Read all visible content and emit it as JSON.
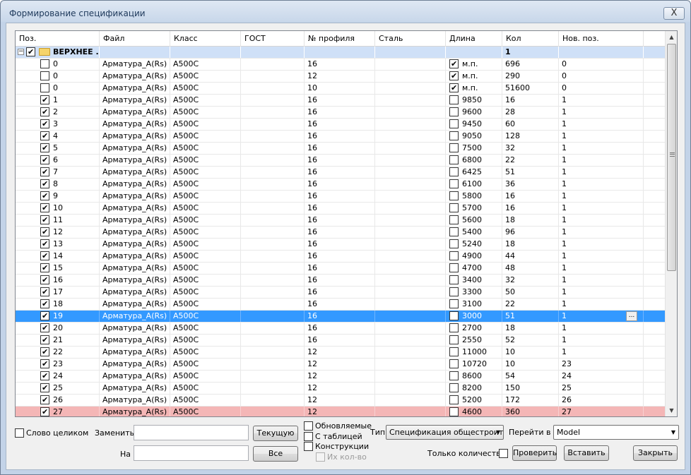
{
  "window": {
    "title": "Формирование спецификации",
    "close_glyph": "X"
  },
  "grid": {
    "columns": [
      "Поз.",
      "Файл",
      "Класс",
      "ГОСТ",
      "№ профиля",
      "Сталь",
      "Длина",
      "Кол",
      "Нов. поз."
    ],
    "group_row": {
      "name": "ВЕРХНЕЕ .",
      "qty": "1",
      "checked": true
    },
    "rows": [
      {
        "pos": "0",
        "checked": false,
        "file": "Арматура_A(Rs)",
        "cls": "A500C",
        "gost": "",
        "profile": "16",
        "steel": "",
        "len_checked": true,
        "len": "м.п.",
        "qty": "696",
        "newpos": "0"
      },
      {
        "pos": "0",
        "checked": false,
        "file": "Арматура_A(Rs)",
        "cls": "A500C",
        "gost": "",
        "profile": "12",
        "steel": "",
        "len_checked": true,
        "len": "м.п.",
        "qty": "290",
        "newpos": "0"
      },
      {
        "pos": "0",
        "checked": false,
        "file": "Арматура_A(Rs)",
        "cls": "A500C",
        "gost": "",
        "profile": "10",
        "steel": "",
        "len_checked": true,
        "len": "м.п.",
        "qty": "51600",
        "newpos": "0"
      },
      {
        "pos": "1",
        "checked": true,
        "file": "Арматура_A(Rs)",
        "cls": "A500C",
        "gost": "",
        "profile": "16",
        "steel": "",
        "len_checked": false,
        "len": "9850",
        "qty": "16",
        "newpos": "1"
      },
      {
        "pos": "2",
        "checked": true,
        "file": "Арматура_A(Rs)",
        "cls": "A500C",
        "gost": "",
        "profile": "16",
        "steel": "",
        "len_checked": false,
        "len": "9600",
        "qty": "28",
        "newpos": "1"
      },
      {
        "pos": "3",
        "checked": true,
        "file": "Арматура_A(Rs)",
        "cls": "A500C",
        "gost": "",
        "profile": "16",
        "steel": "",
        "len_checked": false,
        "len": "9450",
        "qty": "60",
        "newpos": "1"
      },
      {
        "pos": "4",
        "checked": true,
        "file": "Арматура_A(Rs)",
        "cls": "A500C",
        "gost": "",
        "profile": "16",
        "steel": "",
        "len_checked": false,
        "len": "9050",
        "qty": "128",
        "newpos": "1"
      },
      {
        "pos": "5",
        "checked": true,
        "file": "Арматура_A(Rs)",
        "cls": "A500C",
        "gost": "",
        "profile": "16",
        "steel": "",
        "len_checked": false,
        "len": "7500",
        "qty": "32",
        "newpos": "1"
      },
      {
        "pos": "6",
        "checked": true,
        "file": "Арматура_A(Rs)",
        "cls": "A500C",
        "gost": "",
        "profile": "16",
        "steel": "",
        "len_checked": false,
        "len": "6800",
        "qty": "22",
        "newpos": "1"
      },
      {
        "pos": "7",
        "checked": true,
        "file": "Арматура_A(Rs)",
        "cls": "A500C",
        "gost": "",
        "profile": "16",
        "steel": "",
        "len_checked": false,
        "len": "6425",
        "qty": "51",
        "newpos": "1"
      },
      {
        "pos": "8",
        "checked": true,
        "file": "Арматура_A(Rs)",
        "cls": "A500C",
        "gost": "",
        "profile": "16",
        "steel": "",
        "len_checked": false,
        "len": "6100",
        "qty": "36",
        "newpos": "1"
      },
      {
        "pos": "9",
        "checked": true,
        "file": "Арматура_A(Rs)",
        "cls": "A500C",
        "gost": "",
        "profile": "16",
        "steel": "",
        "len_checked": false,
        "len": "5800",
        "qty": "16",
        "newpos": "1"
      },
      {
        "pos": "10",
        "checked": true,
        "file": "Арматура_A(Rs)",
        "cls": "A500C",
        "gost": "",
        "profile": "16",
        "steel": "",
        "len_checked": false,
        "len": "5700",
        "qty": "16",
        "newpos": "1"
      },
      {
        "pos": "11",
        "checked": true,
        "file": "Арматура_A(Rs)",
        "cls": "A500C",
        "gost": "",
        "profile": "16",
        "steel": "",
        "len_checked": false,
        "len": "5600",
        "qty": "18",
        "newpos": "1"
      },
      {
        "pos": "12",
        "checked": true,
        "file": "Арматура_A(Rs)",
        "cls": "A500C",
        "gost": "",
        "profile": "16",
        "steel": "",
        "len_checked": false,
        "len": "5400",
        "qty": "96",
        "newpos": "1"
      },
      {
        "pos": "13",
        "checked": true,
        "file": "Арматура_A(Rs)",
        "cls": "A500C",
        "gost": "",
        "profile": "16",
        "steel": "",
        "len_checked": false,
        "len": "5240",
        "qty": "18",
        "newpos": "1"
      },
      {
        "pos": "14",
        "checked": true,
        "file": "Арматура_A(Rs)",
        "cls": "A500C",
        "gost": "",
        "profile": "16",
        "steel": "",
        "len_checked": false,
        "len": "4900",
        "qty": "44",
        "newpos": "1"
      },
      {
        "pos": "15",
        "checked": true,
        "file": "Арматура_A(Rs)",
        "cls": "A500C",
        "gost": "",
        "profile": "16",
        "steel": "",
        "len_checked": false,
        "len": "4700",
        "qty": "48",
        "newpos": "1"
      },
      {
        "pos": "16",
        "checked": true,
        "file": "Арматура_A(Rs)",
        "cls": "A500C",
        "gost": "",
        "profile": "16",
        "steel": "",
        "len_checked": false,
        "len": "3400",
        "qty": "32",
        "newpos": "1"
      },
      {
        "pos": "17",
        "checked": true,
        "file": "Арматура_A(Rs)",
        "cls": "A500C",
        "gost": "",
        "profile": "16",
        "steel": "",
        "len_checked": false,
        "len": "3300",
        "qty": "50",
        "newpos": "1"
      },
      {
        "pos": "18",
        "checked": true,
        "file": "Арматура_A(Rs)",
        "cls": "A500C",
        "gost": "",
        "profile": "16",
        "steel": "",
        "len_checked": false,
        "len": "3100",
        "qty": "22",
        "newpos": "1"
      },
      {
        "pos": "19",
        "checked": true,
        "file": "Арматура_A(Rs)",
        "cls": "A500C",
        "gost": "",
        "profile": "16",
        "steel": "",
        "len_checked": false,
        "len": "3000",
        "qty": "51",
        "newpos": "1",
        "state": "selected"
      },
      {
        "pos": "20",
        "checked": true,
        "file": "Арматура_A(Rs)",
        "cls": "A500C",
        "gost": "",
        "profile": "16",
        "steel": "",
        "len_checked": false,
        "len": "2700",
        "qty": "18",
        "newpos": "1"
      },
      {
        "pos": "21",
        "checked": true,
        "file": "Арматура_A(Rs)",
        "cls": "A500C",
        "gost": "",
        "profile": "16",
        "steel": "",
        "len_checked": false,
        "len": "2550",
        "qty": "52",
        "newpos": "1"
      },
      {
        "pos": "22",
        "checked": true,
        "file": "Арматура_A(Rs)",
        "cls": "A500C",
        "gost": "",
        "profile": "12",
        "steel": "",
        "len_checked": false,
        "len": "11000",
        "qty": "10",
        "newpos": "1"
      },
      {
        "pos": "23",
        "checked": true,
        "file": "Арматура_A(Rs)",
        "cls": "A500C",
        "gost": "",
        "profile": "12",
        "steel": "",
        "len_checked": false,
        "len": "10720",
        "qty": "10",
        "newpos": "23"
      },
      {
        "pos": "24",
        "checked": true,
        "file": "Арматура_A(Rs)",
        "cls": "A500C",
        "gost": "",
        "profile": "12",
        "steel": "",
        "len_checked": false,
        "len": "8600",
        "qty": "54",
        "newpos": "24"
      },
      {
        "pos": "25",
        "checked": true,
        "file": "Арматура_A(Rs)",
        "cls": "A500C",
        "gost": "",
        "profile": "12",
        "steel": "",
        "len_checked": false,
        "len": "8200",
        "qty": "150",
        "newpos": "25"
      },
      {
        "pos": "26",
        "checked": true,
        "file": "Арматура_A(Rs)",
        "cls": "A500C",
        "gost": "",
        "profile": "12",
        "steel": "",
        "len_checked": false,
        "len": "5200",
        "qty": "172",
        "newpos": "26"
      },
      {
        "pos": "27",
        "checked": true,
        "file": "Арматура_A(Rs)",
        "cls": "A500C",
        "gost": "",
        "profile": "12",
        "steel": "",
        "len_checked": false,
        "len": "4600",
        "qty": "360",
        "newpos": "27",
        "state": "pink"
      }
    ],
    "ellipsis_label": "..."
  },
  "controls": {
    "whole_word_label": "Слово целиком",
    "replace_label": "Заменить",
    "replace_value": "",
    "current_button": "Текущую",
    "with_label": "На",
    "with_value": "",
    "all_button": "Все",
    "updated_label": "Обновляемые",
    "with_table_label": "С таблицей",
    "constructions_label": "Конструкции",
    "their_qty_label": "Их кол-во",
    "type_label": "Тип",
    "type_value": "Спецификация общестроите",
    "goto_label": "Перейти в",
    "goto_value": "Model",
    "only_qty_label": "Только количество",
    "check_button": "Проверить",
    "insert_button": "Вставить",
    "close_button": "Закрыть"
  },
  "colors": {
    "selected_row": "#3399ff",
    "group_row": "#cfe0f7",
    "highlight_row": "#f4b6b6"
  },
  "icons": {
    "expander": "minus-box",
    "group_icon": "folder-icon",
    "scroll_up": "▲",
    "scroll_down": "▼",
    "dropdown": "▼"
  }
}
